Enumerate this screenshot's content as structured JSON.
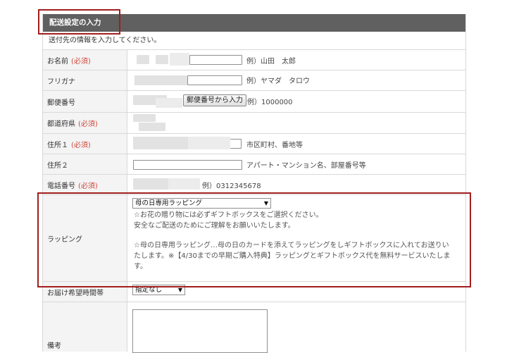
{
  "section": {
    "title": "配送設定の入力",
    "intro": "送付先の情報を入力してください。"
  },
  "required_mark": "(必須)",
  "fields": {
    "name": {
      "label": "お名前",
      "example": "例）山田　太郎"
    },
    "kana": {
      "label": "フリガナ",
      "example": "例）ヤマダ　タロウ"
    },
    "postal": {
      "label": "郵便番号",
      "button": "郵便番号から入力",
      "example": "例）1000000"
    },
    "prefecture": {
      "label": "都道府県"
    },
    "address1": {
      "label": "住所１",
      "example": "市区町村、番地等"
    },
    "address2": {
      "label": "住所２",
      "example": "アパート・マンション名、部屋番号等"
    },
    "phone": {
      "label": "電話番号",
      "example": "例）0312345678"
    },
    "wrapping": {
      "label": "ラッピング",
      "selected": "母の日専用ラッピング",
      "note1": "☆お花の贈り物には必ずギフトボックスをご選択ください。",
      "note2": "安全なご配送のためにご理解をお願いいたします。",
      "note3": "☆母の日専用ラッピング…母の日のカードを添えてラッピングをしギフトボックスに入れてお送りい",
      "note4": "たします。※【4/30までの早期ご購入特典】ラッピングとギフトボックス代を無料サービスいたしま",
      "note5": "す。"
    },
    "delivery_time": {
      "label": "お届け希望時間帯",
      "selected": "指定なし"
    },
    "remarks": {
      "label": "備考"
    }
  },
  "icons": {
    "dropdown": "▼"
  },
  "colors": {
    "highlight": "#a21e1e",
    "header_bg": "#606060",
    "required": "#d0473a"
  }
}
